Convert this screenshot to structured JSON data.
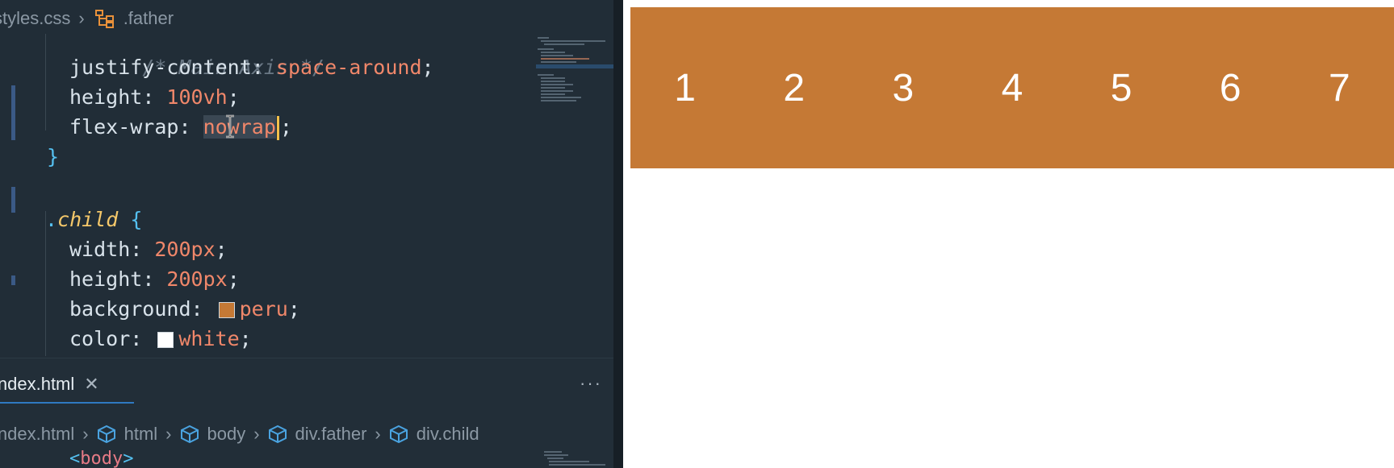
{
  "editor": {
    "breadcrumb_top": {
      "file": "styles.css",
      "symbol": ".father"
    },
    "code_lines": [
      {
        "comment": "/* Main Axis */"
      },
      {
        "prop": "justify-content",
        "value": "space-around"
      },
      {
        "prop": "height",
        "value": "100vh"
      },
      {
        "prop": "flex-wrap",
        "value_before_cursor": "nowrap"
      },
      {
        "brace": "}"
      },
      {
        "selector_dot": ".",
        "selector": "child",
        "brace_open": "{"
      },
      {
        "prop": "width",
        "value": "200px"
      },
      {
        "prop": "height",
        "value": "200px"
      },
      {
        "prop": "background",
        "value": "peru",
        "swatch": "#c57935"
      },
      {
        "prop": "color",
        "value": "white",
        "swatch": "#ffffff"
      }
    ]
  },
  "panel": {
    "tab_label": "index.html",
    "more_label": "···",
    "breadcrumb": [
      "index.html",
      "html",
      "body",
      "div.father",
      "div.child"
    ],
    "partial_line": {
      "open": "<",
      "tag": "body",
      "close": ">"
    }
  },
  "preview": {
    "children": [
      "1",
      "2",
      "3",
      "4",
      "5",
      "6",
      "7"
    ]
  },
  "colors": {
    "peru": "#c57935",
    "accent": "#2f79c2",
    "cursor": "#f2c04a"
  }
}
